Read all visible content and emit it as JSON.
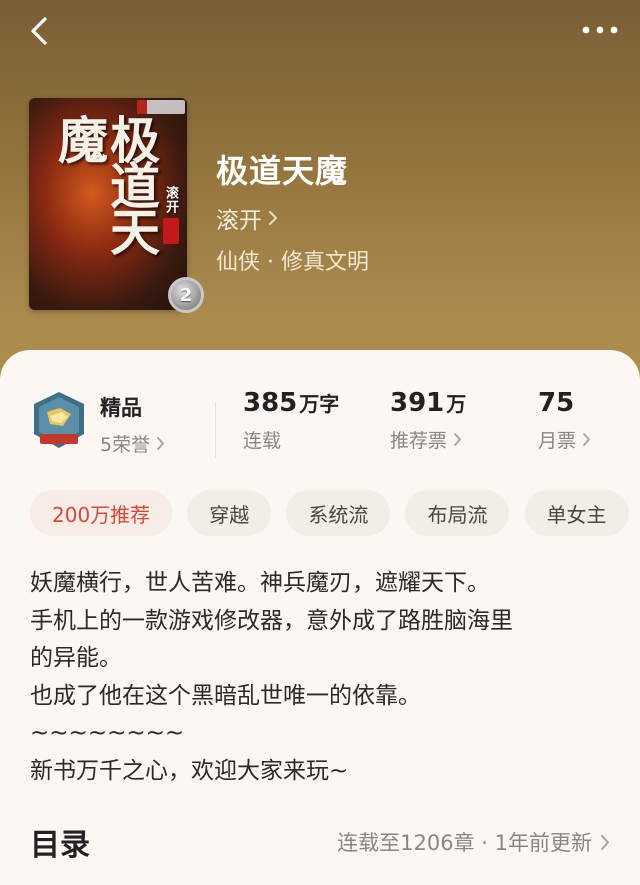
{
  "nav": {
    "back_icon": "back-arrow-icon",
    "more_icon": "more-dots-icon"
  },
  "book": {
    "title": "极道天魔",
    "author": "滚开",
    "genre": "仙侠 · 修真文明",
    "volume_badge": "2",
    "cover": {
      "title": "极道天魔",
      "author": "滚开"
    }
  },
  "stats": {
    "honor": {
      "title": "精品",
      "sub": "5荣誉"
    },
    "words": {
      "value": "385",
      "unit": "万字",
      "sub": "连载"
    },
    "recommend": {
      "value": "391",
      "unit": "万",
      "sub": "推荐票"
    },
    "monthly": {
      "value": "75",
      "sub": "月票"
    }
  },
  "tags": [
    "200万推荐",
    "穿越",
    "系统流",
    "布局流",
    "单女主"
  ],
  "intro": [
    "妖魔横行，世人苦难。神兵魔刃，遮耀天下。",
    "手机上的一款游戏修改器，意外成了路胜脑海里",
    "的异能。",
    "也成了他在这个黑暗乱世唯一的依靠。",
    "~~~~~~~~",
    "新书万千之心，欢迎大家来玩~"
  ],
  "catalog": {
    "label": "目录",
    "status": "连载至1206章 · 1年前更新"
  },
  "colors": {
    "hero_bg": "#9a7a40",
    "sheet_bg": "#fcf7f2",
    "accent_red": "#d8483a",
    "muted": "#8b8682"
  }
}
